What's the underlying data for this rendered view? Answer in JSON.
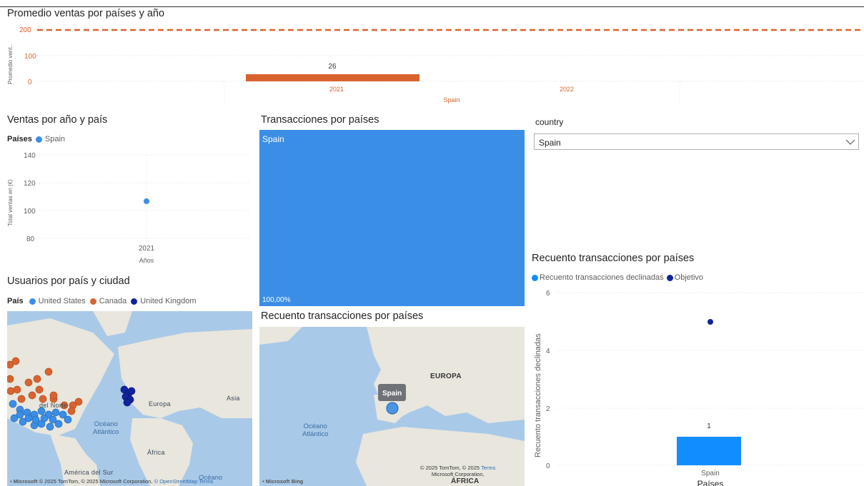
{
  "colors": {
    "orange": "#d9632f",
    "blue": "#3a8ee6",
    "navy": "#12239e",
    "mapSea": "#a9c9e8",
    "mapLand": "#e8e6dd",
    "bar": "#118dff"
  },
  "top": {
    "title": "Promedio ventas por países y año",
    "ylabel": "Promedio vent..",
    "target_value": "200",
    "ticks": [
      "200",
      "100",
      "0"
    ],
    "bar_label": "26",
    "x_years": [
      "2021",
      "2022"
    ],
    "x_country": "Spain"
  },
  "ventas": {
    "title": "Ventas por año y país",
    "legend_title": "Países",
    "legend_item": "Spain",
    "ylabel": "Total ventas en (€)",
    "xlabel": "Años",
    "yticks": [
      "140",
      "120",
      "100",
      "80"
    ],
    "xtick": "2021"
  },
  "transacciones": {
    "title": "Transacciones por países",
    "tile_label": "Spain",
    "tile_pct": "100,00%"
  },
  "filter": {
    "label": "country",
    "selected": "Spain"
  },
  "usuarios": {
    "title": "Usuarios por país y ciudad",
    "legend_title": "País",
    "legend": [
      "United States",
      "Canada",
      "United Kingdom"
    ],
    "map_labels": {
      "north": "del Norte",
      "europa": "Europa",
      "asia": "Asia",
      "africa": "África",
      "sur": "América del Sur",
      "oceano1": "Océano",
      "oceano1b": "Atlántico",
      "oceano2": "Océano"
    },
    "attribution": "© 2025 TomTom, © 2025 Microsoft Corporation,",
    "attribution_link1": "© OpenStreetMap",
    "attribution_link2": "Terms"
  },
  "recuento_map": {
    "title": "Recuento transacciones por países",
    "tooltip": "Spain",
    "labels": {
      "europa": "EUROPA",
      "oceano": "Océano",
      "oceano2": "Atlántico",
      "africa": "ÁFRICA"
    },
    "attribution": "© 2025 TomTom, © 2025",
    "attribution2": "Microsoft Corporation,",
    "attribution_link": "Terms"
  },
  "recuento_chart": {
    "title": "Recuento transacciones por países",
    "legend": [
      "Recuento transacciones declinadas",
      "Objetivo"
    ],
    "ylabel": "Recuento transacciones declinadas",
    "xlabel": "Países",
    "yticks": [
      "6",
      "4",
      "2",
      "0"
    ],
    "bar_label": "1",
    "category": "Spain"
  },
  "chart_data": [
    {
      "type": "bar",
      "title": "Promedio ventas por países y año",
      "ylabel": "Promedio vent..",
      "categories": [
        "2021"
      ],
      "group": "Spain",
      "values": [
        26
      ],
      "target": 200,
      "ylim": [
        0,
        200
      ]
    },
    {
      "type": "scatter",
      "title": "Ventas por año y país",
      "xlabel": "Años",
      "ylabel": "Total ventas en (€)",
      "series": [
        {
          "name": "Spain",
          "x": [
            "2021"
          ],
          "y": [
            107
          ]
        }
      ],
      "ylim": [
        80,
        140
      ]
    },
    {
      "type": "bar",
      "title": "Recuento transacciones por países",
      "xlabel": "Países",
      "ylabel": "Recuento transacciones declinadas",
      "categories": [
        "Spain"
      ],
      "series": [
        {
          "name": "Recuento transacciones declinadas",
          "values": [
            1
          ]
        },
        {
          "name": "Objetivo",
          "values": [
            5
          ]
        }
      ],
      "ylim": [
        0,
        6
      ]
    }
  ]
}
